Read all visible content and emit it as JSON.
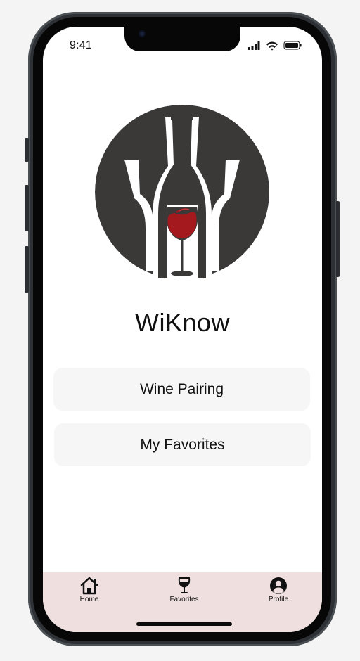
{
  "status_bar": {
    "time": "9:41"
  },
  "app": {
    "title": "WiKnow"
  },
  "menu": {
    "wine_pairing_label": "Wine Pairing",
    "favorites_label": "My Favorites"
  },
  "tab_bar": {
    "items": [
      {
        "label": "Home",
        "icon": "home-icon"
      },
      {
        "label": "Favorites",
        "icon": "wine-glass-icon"
      },
      {
        "label": "Profile",
        "icon": "profile-icon"
      }
    ]
  },
  "colors": {
    "logo_dark": "#3b3838",
    "wine_red": "#a3191d",
    "tab_bar_bg": "#efe0df",
    "button_bg": "#f6f6f6"
  }
}
